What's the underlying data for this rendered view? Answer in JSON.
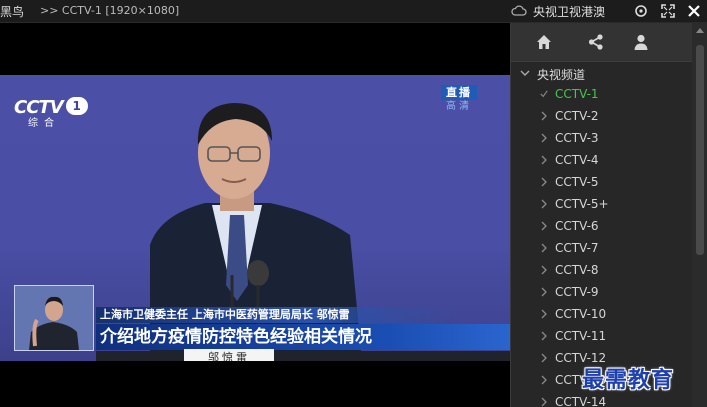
{
  "titlebar": {
    "app_name": "黑鸟",
    "now_playing": ">> CCTV-1  [1920×1080]",
    "category": "央视卫视港澳"
  },
  "video": {
    "logo_word": "CCTV",
    "logo_number": "1",
    "logo_sub": "综合",
    "live_badge": "直播",
    "hd_badge": "高清",
    "caption_small": "上海市卫健委主任 上海市中医药管理局局长 邬惊雷",
    "caption_main": "介绍地方疫情防控特色经验相关情况",
    "nameplate": "邬惊雷"
  },
  "sidebar": {
    "group_label": "央视频道",
    "channels": [
      "CCTV-1",
      "CCTV-2",
      "CCTV-3",
      "CCTV-4",
      "CCTV-5",
      "CCTV-5+",
      "CCTV-6",
      "CCTV-7",
      "CCTV-8",
      "CCTV-9",
      "CCTV-10",
      "CCTV-11",
      "CCTV-12",
      "CCTV-13",
      "CCTV-14"
    ],
    "active_channel": "CCTV-1"
  },
  "watermark": "最需教育",
  "colors": {
    "active": "#43c84a",
    "panel_bg": "#272727",
    "studio_bg": "#4a4ea4",
    "caption_blue": "#1b4eb3"
  }
}
